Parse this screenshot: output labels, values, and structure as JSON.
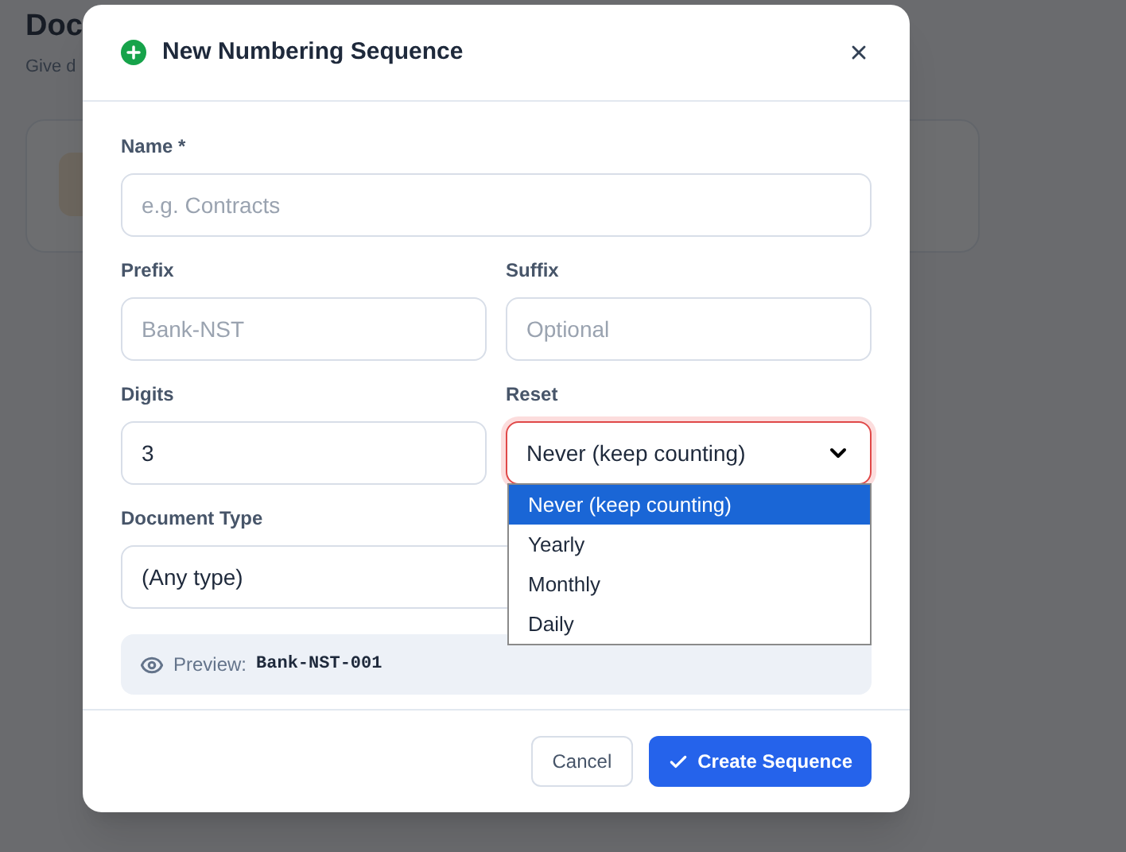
{
  "page": {
    "title": "Doc",
    "subtitle": "Give d"
  },
  "dialog": {
    "title": "New Numbering Sequence",
    "rows": [
      [
        {
          "kind": "text",
          "label": "Name *",
          "placeholder": "e.g. Contracts"
        }
      ],
      [
        {
          "kind": "text",
          "label": "Prefix",
          "placeholder": "Bank-NST"
        },
        {
          "kind": "text",
          "label": "Suffix",
          "placeholder": "Optional"
        }
      ],
      [
        {
          "kind": "text",
          "label": "Digits",
          "value": "3"
        },
        {
          "kind": "select",
          "label": "Reset",
          "value": "Never (keep counting)",
          "focused": true,
          "open": true,
          "options": [
            {
              "label": "Never (keep counting)",
              "selected": true
            },
            {
              "label": "Yearly",
              "selected": false
            },
            {
              "label": "Monthly",
              "selected": false
            },
            {
              "label": "Daily",
              "selected": false
            }
          ]
        }
      ],
      [
        {
          "kind": "select",
          "label": "Document Type",
          "value": "(Any type)",
          "focused": false
        }
      ]
    ],
    "preview": {
      "label": "Preview:",
      "value": "Bank-NST-001"
    },
    "buttons": [
      {
        "kind": "secondary",
        "label": "Cancel"
      },
      {
        "kind": "primary",
        "label": "Create Sequence"
      }
    ]
  }
}
